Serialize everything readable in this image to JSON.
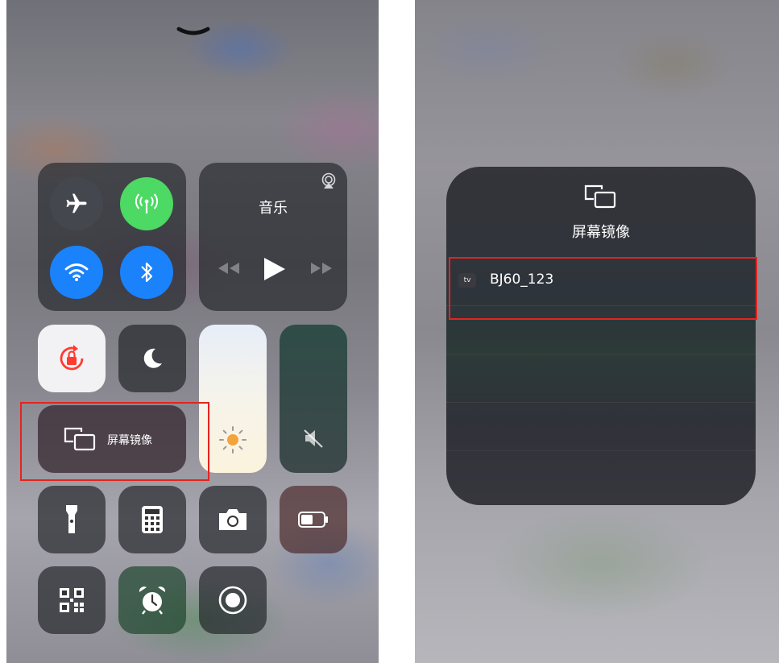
{
  "left_panel": {
    "music_title": "音乐",
    "screen_mirroring_label": "屏幕镜像"
  },
  "right_panel": {
    "title": "屏幕镜像",
    "device_badge": "tv",
    "device_name": "BJ60_123"
  },
  "colors": {
    "cellular_green": "#4cd964",
    "blue_active": "#1a82fb",
    "highlight_red": "#e5231f",
    "rotation_lock_red": "#ff3b30"
  }
}
